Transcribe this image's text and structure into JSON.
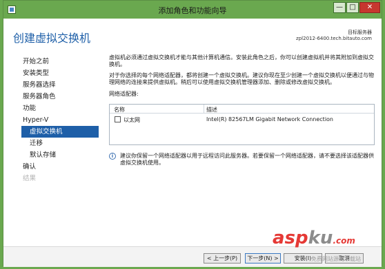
{
  "window": {
    "title": "添加角色和功能向导",
    "minimize": "—",
    "maximize": "□",
    "close": "✕"
  },
  "header": {
    "page_title": "创建虚拟交换机",
    "server_label": "目标服务器",
    "server_name": "zpl2012-6400.tech.bitauto.com"
  },
  "nav": {
    "items": [
      {
        "label": "开始之前",
        "state": "normal"
      },
      {
        "label": "安装类型",
        "state": "normal"
      },
      {
        "label": "服务器选择",
        "state": "normal"
      },
      {
        "label": "服务器角色",
        "state": "normal"
      },
      {
        "label": "功能",
        "state": "normal"
      },
      {
        "label": "Hyper-V",
        "state": "normal"
      },
      {
        "label": "虚拟交换机",
        "state": "active"
      },
      {
        "label": "迁移",
        "state": "sub"
      },
      {
        "label": "默认存储",
        "state": "sub"
      },
      {
        "label": "确认",
        "state": "normal"
      },
      {
        "label": "结果",
        "state": "disabled"
      }
    ]
  },
  "content": {
    "para1": "虚拟机必须通过虚拟交换机才能与其他计算机通信。安装此角色之后，你可以创建虚拟机并将其附加到虚拟交换机。",
    "para2": "对于你选择的每个网络适配器，都将创建一个虚拟交换机。建议你现在至少创建一个虚拟交换机以便通过与物理网络的连接来提供虚拟机。稍后可以使用虚拟交换机管理器添加、删除或修改虚拟交换机。",
    "adapters_label": "网络适配器:",
    "table": {
      "headers": {
        "name": "名称",
        "desc": "描述"
      },
      "rows": [
        {
          "checked": false,
          "name": "以太网",
          "desc": "Intel(R) 82567LM Gigabit Network Connection"
        }
      ]
    },
    "note": "建议你保留一个网络适配器以用于远程访问此服务器。若要保留一个网络适配器，请不要选择该适配器供虚拟交换机使用。"
  },
  "footer": {
    "prev": "< 上一步(P)",
    "next": "下一步(N) >",
    "install": "安装(I)",
    "cancel": "取消"
  },
  "watermark": {
    "main": "asp",
    "k": "ku",
    "tld": ".com",
    "sub": "免费网站源码下载站"
  }
}
